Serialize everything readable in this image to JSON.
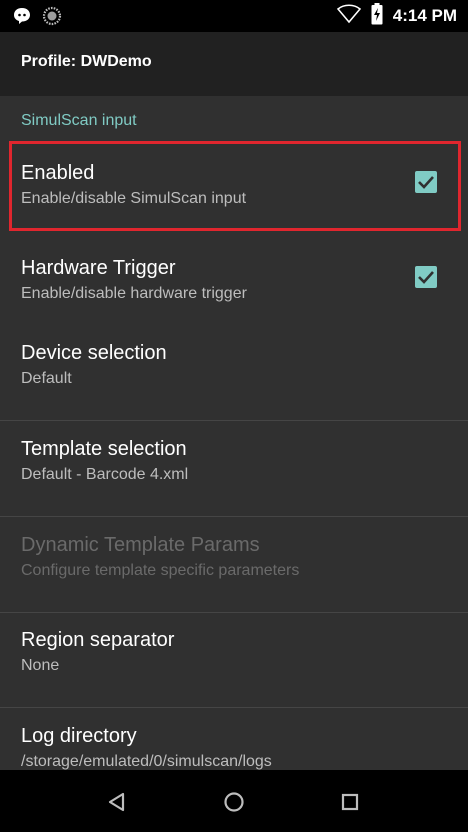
{
  "status_bar": {
    "time": "4:14 PM",
    "icons": [
      "message-icon",
      "scanner-notification-icon",
      "wifi-icon",
      "battery-charging-icon"
    ]
  },
  "toolbar": {
    "title": "Profile: DWDemo"
  },
  "category": {
    "title": "SimulScan input"
  },
  "preferences": [
    {
      "title": "Enabled",
      "summary": "Enable/disable SimulScan input",
      "checked": true
    },
    {
      "title": "Hardware Trigger",
      "summary": "Enable/disable hardware trigger",
      "checked": true
    },
    {
      "title": "Device selection",
      "summary": "Default"
    },
    {
      "title": "Template selection",
      "summary": "Default - Barcode 4.xml"
    },
    {
      "title": "Dynamic Template Params",
      "summary": "Configure template specific parameters",
      "disabled": true
    },
    {
      "title": "Region separator",
      "summary": "None"
    },
    {
      "title": "Log directory",
      "summary": "/storage/emulated/0/simulscan/logs"
    }
  ],
  "colors": {
    "accent": "#80cbc4",
    "highlight": "#e0262e",
    "background": "#303030",
    "toolbar": "#212121"
  },
  "navigation": [
    "back-icon",
    "home-icon",
    "recents-icon"
  ]
}
